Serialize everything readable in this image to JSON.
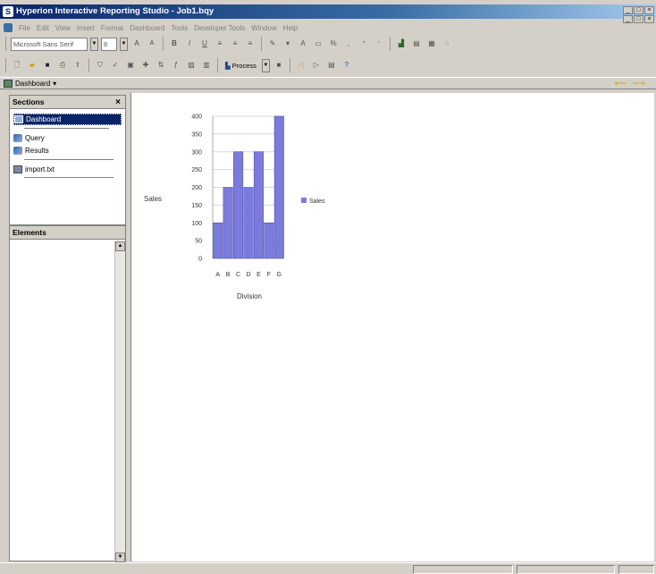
{
  "window": {
    "title": "Hyperion Interactive Reporting Studio - Job1.bqy",
    "min_label": "_",
    "restore_label": "□",
    "close_label": "×"
  },
  "menu": {
    "items": [
      "File",
      "Edit",
      "View",
      "Insert",
      "Format",
      "Dashboard",
      "Tools",
      "Developer Tools",
      "Window",
      "Help"
    ]
  },
  "toolbar": {
    "font_value": "Microsoft Sans Serif",
    "size_value": "8",
    "process_label": "Process"
  },
  "nav": {
    "current_section": "Dashboard"
  },
  "sections_panel": {
    "title": "Sections",
    "items": [
      "Dashboard",
      "Query",
      "Results",
      "import.txt"
    ]
  },
  "elements_panel": {
    "title": "Elements"
  },
  "chart_data": {
    "type": "bar",
    "categories": [
      "A",
      "B",
      "C",
      "D",
      "E",
      "F",
      "G"
    ],
    "series": [
      {
        "name": "Sales",
        "values": [
          100,
          200,
          300,
          200,
          300,
          100,
          400
        ]
      }
    ],
    "ylabel": "Sales",
    "xlabel": "Division",
    "ylim": [
      0,
      400
    ],
    "yticks": [
      0,
      50,
      100,
      150,
      200,
      250,
      300,
      350,
      400
    ],
    "legend": "right",
    "grid": true,
    "bar_color": "#7b7bdc"
  }
}
